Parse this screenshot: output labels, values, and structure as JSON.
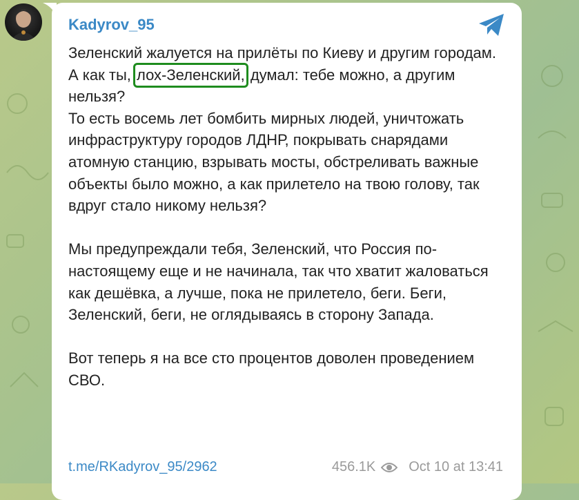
{
  "channel": {
    "name": "Kadyrov_95",
    "avatar": "avatar"
  },
  "message": {
    "paragraph1_before": "Зеленский жалуется на прилёты по Киеву и другим городам.",
    "line2_prefix": "А как ты, ",
    "line2_highlight": "лох-Зеленский,",
    "line2_suffix": " думал: тебе можно, а другим нельзя?",
    "paragraph1_after": "То есть восемь лет бомбить мирных людей, уничтожать инфраструктуру городов ЛДНР, покрывать снарядами атомную станцию, взрывать мосты, обстреливать важные объекты было можно, а как прилетело на твою голову, так вдруг стало никому нельзя?",
    "paragraph2": "Мы предупреждали тебя, Зеленский, что Россия по-настоящему еще и не начинала, так что хватит жаловаться как дешёвка, а лучше, пока не прилетело, беги. Беги, Зеленский, беги, не оглядываясь в сторону Запада.",
    "paragraph3": "Вот теперь я на все сто процентов доволен проведением СВО.",
    "link": "t.me/RKadyrov_95/2962",
    "views": "456.1K",
    "timestamp": "Oct 10 at 13:41"
  },
  "icons": {
    "share": "telegram-share-icon",
    "views": "eye-icon"
  },
  "colors": {
    "accent": "#3b89c6",
    "highlight_border": "#1e8c1e"
  }
}
